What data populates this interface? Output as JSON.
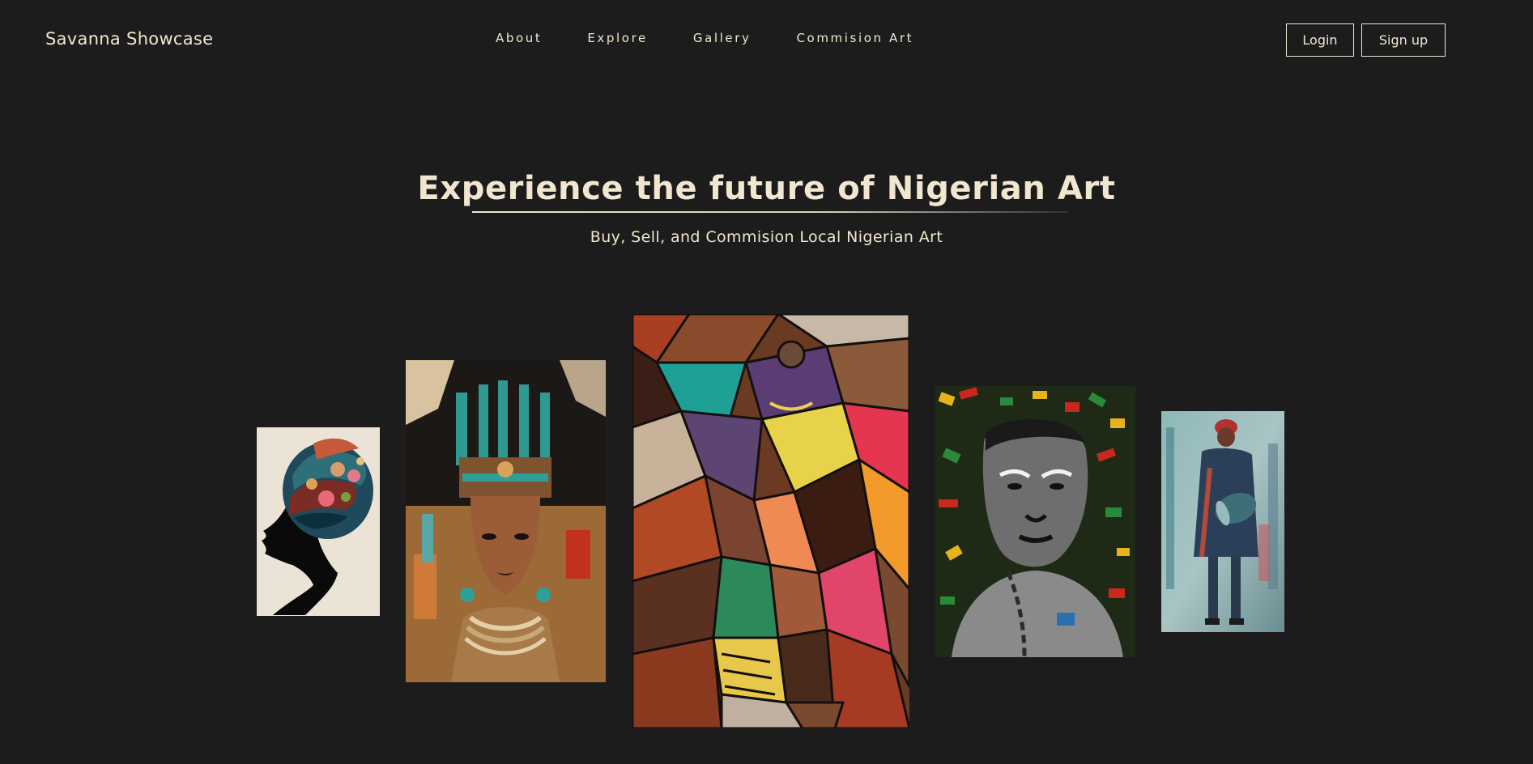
{
  "header": {
    "brand": "Savanna Showcase",
    "nav": [
      "About",
      "Explore",
      "Gallery",
      "Commision Art"
    ],
    "login_label": "Login",
    "signup_label": "Sign up"
  },
  "hero": {
    "title": "Experience the future of Nigerian Art",
    "subtitle": "Buy, Sell, and Commision Local Nigerian Art"
  },
  "gallery": {
    "artworks": [
      {
        "name": "headwrap-silhouette"
      },
      {
        "name": "queen-portrait"
      },
      {
        "name": "geometric-figures"
      },
      {
        "name": "man-portrait"
      },
      {
        "name": "drummer-painting"
      }
    ]
  },
  "colors": {
    "background": "#1c1c1c",
    "text": "#f1e6cf"
  }
}
